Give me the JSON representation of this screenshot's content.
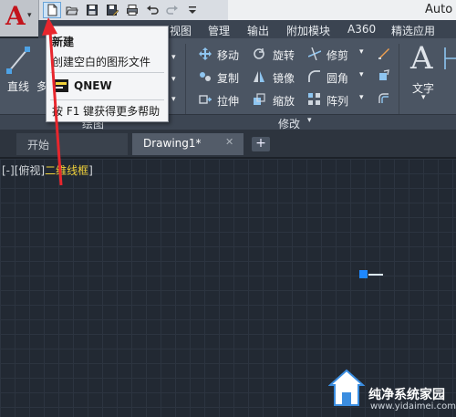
{
  "window": {
    "title_partial": "Auto"
  },
  "quick_access": {
    "icons": [
      "new-file-icon",
      "open-file-icon",
      "save-icon",
      "save-as-icon",
      "plot-icon",
      "undo-icon",
      "redo-icon",
      "customize-icon"
    ]
  },
  "ribbon_tabs": [
    "视图",
    "管理",
    "输出",
    "附加模块",
    "A360",
    "精选应用"
  ],
  "ribbon": {
    "draw": {
      "line_label": "直线",
      "multi_label": "多",
      "footer": "绘图"
    },
    "modify": {
      "move": "移动",
      "rotate": "旋转",
      "trim": "修剪",
      "copy": "复制",
      "mirror": "镜像",
      "fillet": "圆角",
      "stretch": "拉伸",
      "scale": "缩放",
      "array": "阵列",
      "footer": "修改"
    },
    "annotation": {
      "text_label": "文字"
    }
  },
  "dropdown": {
    "heading": "新建",
    "description": "创建空白的图形文件",
    "command": "QNEW",
    "help": "按 F1 键获得更多帮助"
  },
  "file_tabs": [
    {
      "label": "开始"
    },
    {
      "label": "Drawing1*"
    }
  ],
  "viewport": {
    "controls": "[-][俯视]",
    "visual_style": "二维线框",
    "close_bracket": "]"
  },
  "watermark": {
    "title": "纯净系统家园",
    "url": "www.yidaimei.com"
  },
  "colors": {
    "accent_arrow": "#e8262d",
    "autocad_red": "#c3141c",
    "highlight_yellow": "#f2d23a",
    "canvas_bg": "#222933"
  }
}
